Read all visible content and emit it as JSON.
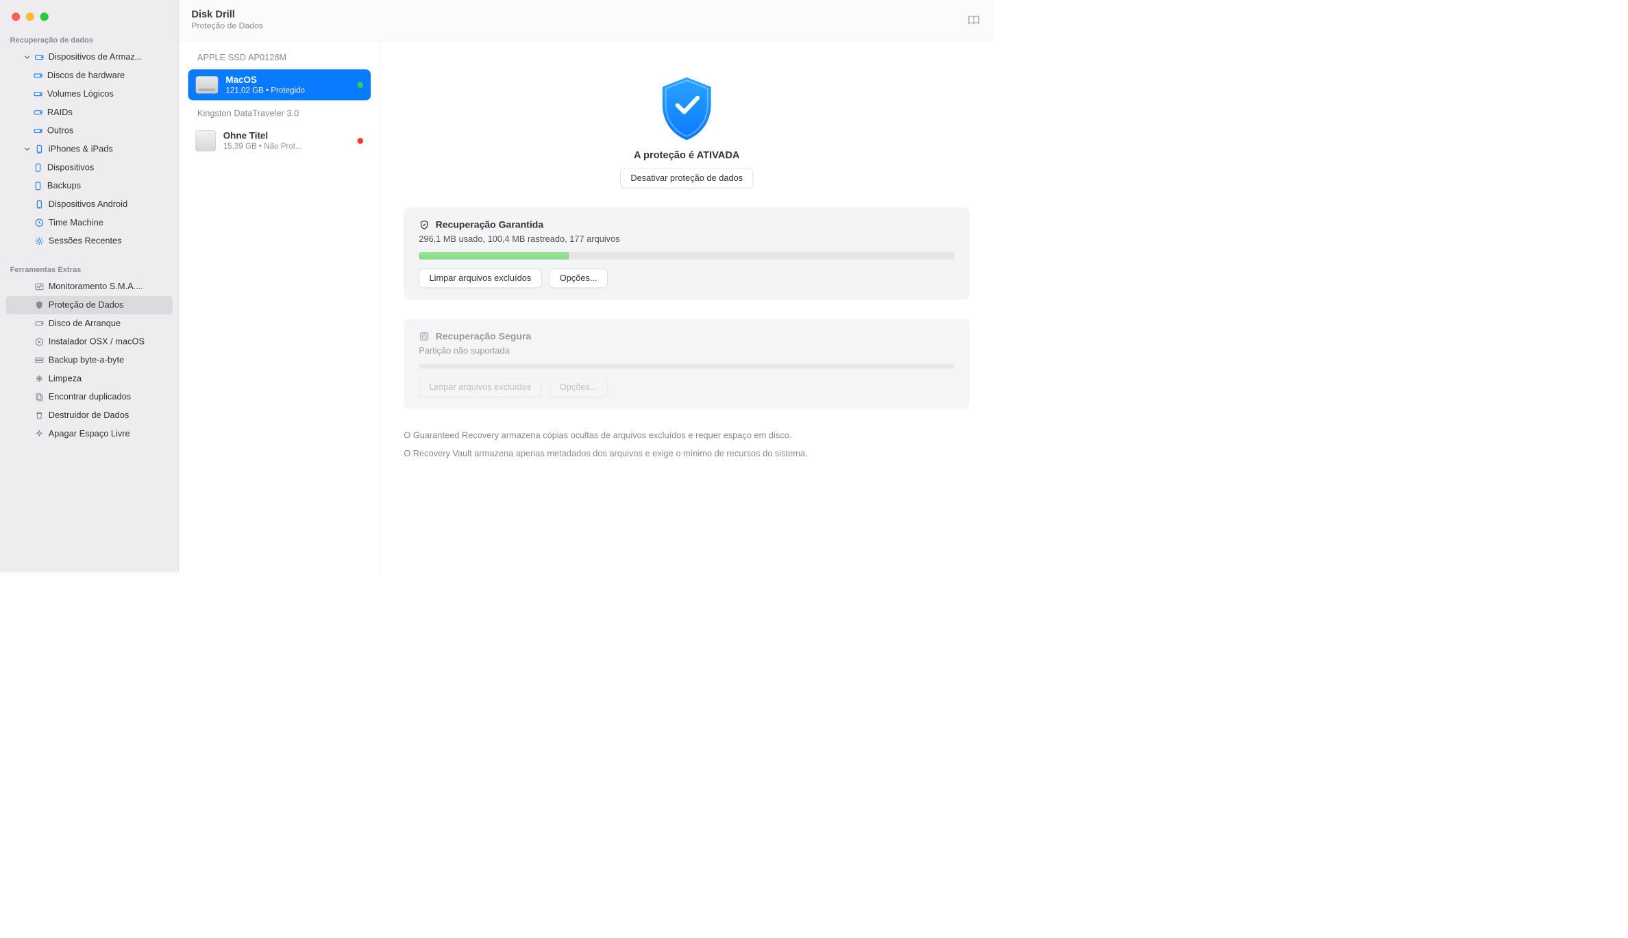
{
  "header": {
    "title": "Disk Drill",
    "subtitle": "Proteção de Dados"
  },
  "sidebar": {
    "section1_title": "Recuperação de dados",
    "storage_devices": "Dispositivos de Armaz...",
    "hardware_disks": "Discos de hardware",
    "logical_volumes": "Volumes Lógicos",
    "raids": "RAIDs",
    "others": "Outros",
    "iphones_ipads": "iPhones & iPads",
    "devices": "Dispositivos",
    "backups": "Backups",
    "android": "Dispositivos Android",
    "time_machine": "Time Machine",
    "recent_sessions": "Sessões Recentes",
    "section2_title": "Ferramentas Extras",
    "smart": "Monitoramento S.M.A....",
    "data_protection": "Proteção de Dados",
    "boot_disk": "Disco de Arranque",
    "osx_installer": "Instalador OSX / macOS",
    "byte_backup": "Backup byte-a-byte",
    "cleanup": "Limpeza",
    "find_dupes": "Encontrar duplicados",
    "data_shredder": "Destruidor de Dados",
    "free_space": "Apagar Espaço Livre"
  },
  "volumes": {
    "group1": "APPLE SSD AP0128M",
    "vol1_name": "MacOS",
    "vol1_sub": "121,02 GB • Protegido",
    "group2": "Kingston DataTraveler 3.0",
    "vol2_name": "Ohne Titel",
    "vol2_sub": "15,39 GB • Não Prot..."
  },
  "detail": {
    "status": "A proteção é ATIVADA",
    "disable_btn": "Desativar proteção de dados",
    "card1_title": "Recuperação Garantida",
    "card1_sub": "296,1 MB usado, 100,4 MB rastreado, 177 arquivos",
    "card1_progress_pct": 28,
    "clear_btn": "Limpar arquivos excluídos",
    "options_btn": "Opções...",
    "card2_title": "Recuperação Segura",
    "card2_sub": "Partição não suportada",
    "info1": "O Guaranteed Recovery armazena cópias ocultas de arquivos excluídos e requer espaço em disco.",
    "info2": "O Recovery Vault armazena apenas metadados dos arquivos e exige o mínimo de recursos do sistema."
  }
}
